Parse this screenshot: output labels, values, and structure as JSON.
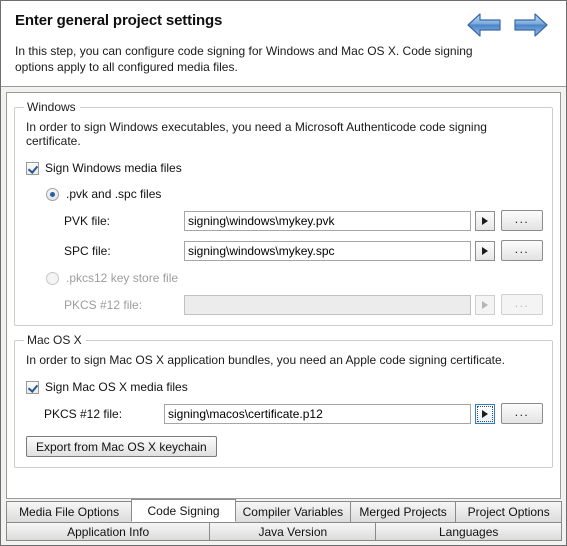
{
  "header": {
    "title": "Enter general project settings",
    "description": "In this step, you can configure code signing for Windows and Mac OS X. Code signing options apply to all configured media files.",
    "back_icon": "back-arrow-icon",
    "forward_icon": "forward-arrow-icon"
  },
  "windows_group": {
    "title": "Windows",
    "description": "In order to sign Windows executables, you need a Microsoft Authenticode code signing certificate.",
    "sign_checkbox": {
      "label": "Sign Windows media files",
      "checked": true
    },
    "radio_pvk": {
      "label": ".pvk and .spc files",
      "selected": true
    },
    "pvk_field": {
      "label": "PVK file:",
      "value": "signing\\windows\\mykey.pvk",
      "placeholder": "",
      "dropdown_icon": "dropdown-triangle-icon",
      "browse_label": "..."
    },
    "spc_field": {
      "label": "SPC file:",
      "value": "signing\\windows\\mykey.spc",
      "placeholder": "",
      "dropdown_icon": "dropdown-triangle-icon",
      "browse_label": "..."
    },
    "radio_pkcs12": {
      "label": ".pkcs12 key store file",
      "selected": false
    },
    "pkcs12_field": {
      "label": "PKCS #12 file:",
      "value": "",
      "placeholder": "",
      "dropdown_icon": "dropdown-triangle-icon",
      "browse_label": "...",
      "disabled": true
    }
  },
  "macos_group": {
    "title": "Mac OS X",
    "description": "In order to sign Mac OS X application bundles, you need an Apple code signing certificate.",
    "sign_checkbox": {
      "label": "Sign Mac OS X media files",
      "checked": true
    },
    "pkcs12_field": {
      "label": "PKCS #12 file:",
      "value": "signing\\macos\\certificate.p12",
      "placeholder": "",
      "dropdown_icon": "dropdown-triangle-icon",
      "browse_label": "..."
    },
    "export_button": "Export from Mac OS X keychain"
  },
  "tabs": {
    "row1": [
      {
        "label": "Media File Options",
        "active": false
      },
      {
        "label": "Code Signing",
        "active": true
      },
      {
        "label": "Compiler Variables",
        "active": false
      },
      {
        "label": "Merged Projects",
        "active": false
      },
      {
        "label": "Project Options",
        "active": false
      }
    ],
    "row2": [
      {
        "label": "Application Info",
        "active": false
      },
      {
        "label": "Java Version",
        "active": false
      },
      {
        "label": "Languages",
        "active": false
      }
    ]
  },
  "colors": {
    "accent": "#2a6099",
    "focus": "#2a7fc9",
    "arrow_blue": "#4a84c8"
  }
}
